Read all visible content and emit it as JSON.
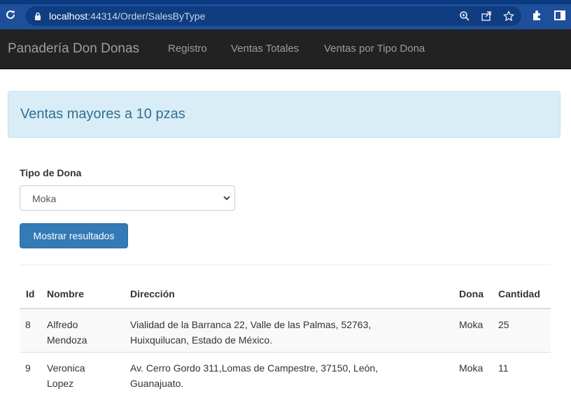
{
  "browser": {
    "url_host": "localhost",
    "url_rest": ":44314/Order/SalesByType",
    "icons": [
      "reload-icon",
      "lock-icon",
      "zoom-icon",
      "share-icon",
      "star-icon",
      "extensions-icon",
      "sidepanel-icon"
    ]
  },
  "navbar": {
    "brand": "Panadería Don Donas",
    "links": [
      "Registro",
      "Ventas Totales",
      "Ventas por Tipo Dona"
    ]
  },
  "alert": {
    "text": "Ventas mayores a 10 pzas"
  },
  "form": {
    "label": "Tipo de Dona",
    "selected": "Moka",
    "button": "Mostrar resultados"
  },
  "table": {
    "headers": [
      "Id",
      "Nombre",
      "Dirección",
      "Dona",
      "Cantidad"
    ],
    "rows": [
      {
        "id": "8",
        "nombre": [
          "Alfredo",
          "Mendoza"
        ],
        "direccion": [
          "Vialidad de la Barranca 22, Valle de las Palmas, 52763,",
          "Huixquilucan, Estado de México."
        ],
        "dona": "Moka",
        "cantidad": "25"
      },
      {
        "id": "9",
        "nombre": [
          "Veronica",
          "Lopez"
        ],
        "direccion": [
          "Av. Cerro Gordo 311,Lomas de Campestre, 37150, León,",
          "Guanajuato."
        ],
        "dona": "Moka",
        "cantidad": "11"
      }
    ]
  },
  "colors": {
    "chrome": "#1e4f9a",
    "navbar": "#222222",
    "alert_bg": "#d9edf7",
    "alert_text": "#31708f",
    "primary": "#337ab7"
  }
}
